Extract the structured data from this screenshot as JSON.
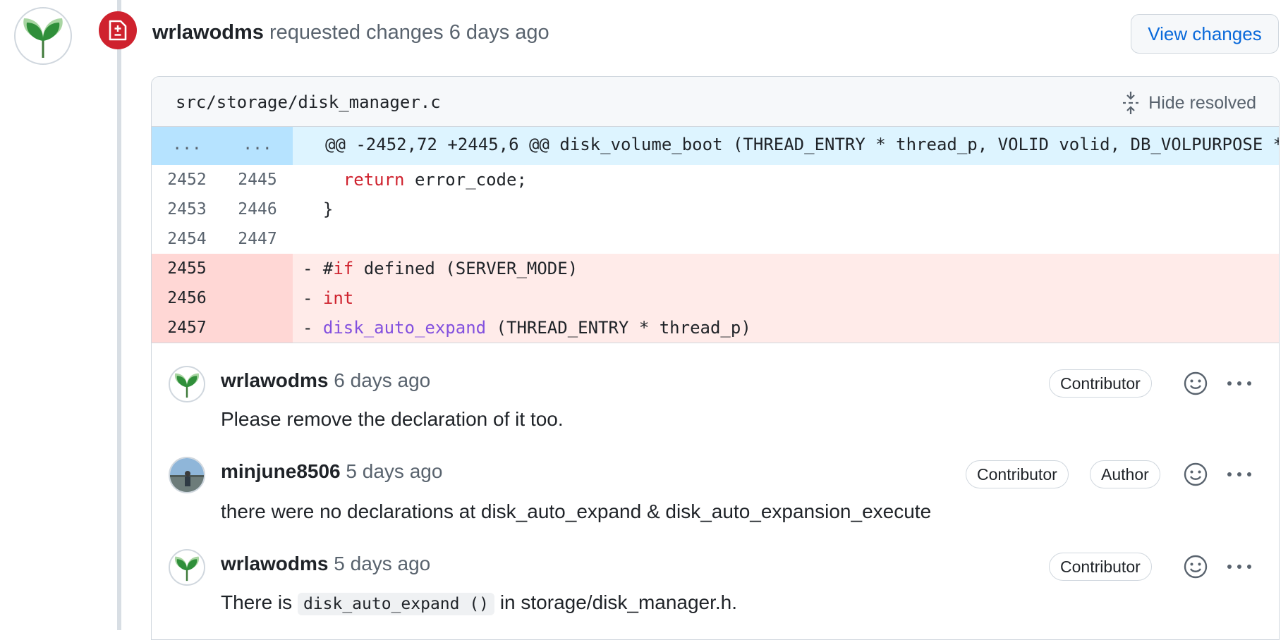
{
  "review": {
    "author": "wrlawodms",
    "action": "requested changes",
    "time": "6 days ago",
    "view_changes_label": "View changes",
    "badge_icon": "file-diff-icon",
    "status_color": "#cf222e"
  },
  "file": {
    "path": "src/storage/disk_manager.c",
    "hide_resolved_label": "Hide resolved"
  },
  "diff": {
    "hunk": {
      "left": "...",
      "right": "...",
      "text": "@@ -2452,72 +2445,6 @@ disk_volume_boot (THREAD_ENTRY * thread_p, VOLID volid, DB_VOLPURPOSE *"
    },
    "lines": [
      {
        "old": "2452",
        "new": "2445",
        "type": "context",
        "text": "  return error_code;"
      },
      {
        "old": "2453",
        "new": "2446",
        "type": "context",
        "text": "}"
      },
      {
        "old": "2454",
        "new": "2447",
        "type": "context",
        "text": ""
      },
      {
        "old": "2455",
        "new": "",
        "type": "deleted",
        "text": "- #if defined (SERVER_MODE)"
      },
      {
        "old": "2456",
        "new": "",
        "type": "deleted",
        "text": "- int"
      },
      {
        "old": "2457",
        "new": "",
        "type": "deleted",
        "text": "- disk_auto_expand (THREAD_ENTRY * thread_p)"
      }
    ]
  },
  "comments": [
    {
      "author": "wrlawodms",
      "time": "6 days ago",
      "badges": [
        "Contributor"
      ],
      "body": "Please remove the declaration of it too."
    },
    {
      "author": "minjune8506",
      "time": "5 days ago",
      "badges": [
        "Contributor",
        "Author"
      ],
      "body": "there were no declarations at disk_auto_expand & disk_auto_expansion_execute"
    },
    {
      "author": "wrlawodms",
      "time": "5 days ago",
      "badges": [
        "Contributor"
      ],
      "body_prefix": "There is",
      "body_code": "disk_auto_expand ()",
      "body_suffix": "in storage/disk_manager.h."
    }
  ]
}
